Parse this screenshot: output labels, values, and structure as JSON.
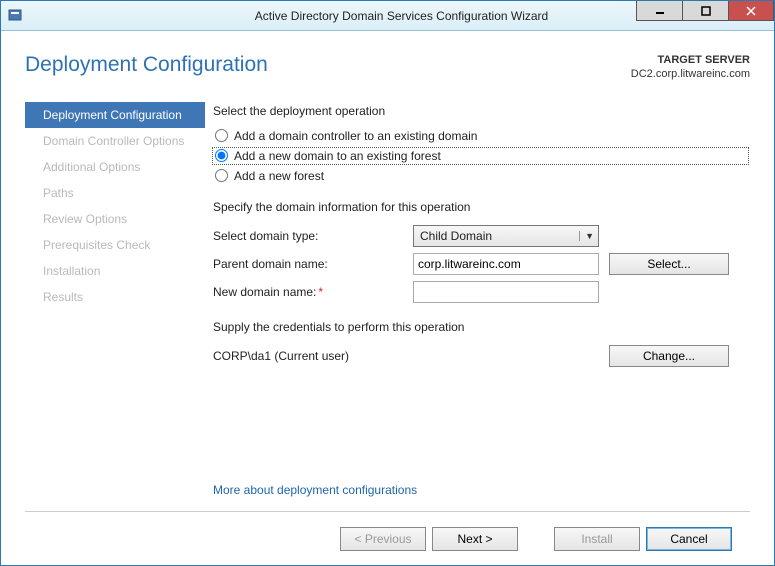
{
  "window": {
    "title": "Active Directory Domain Services Configuration Wizard"
  },
  "header": {
    "page_title": "Deployment Configuration",
    "target_label": "TARGET SERVER",
    "target_server": "DC2.corp.litwareinc.com"
  },
  "sidebar": {
    "items": [
      {
        "label": "Deployment Configuration",
        "active": true
      },
      {
        "label": "Domain Controller Options"
      },
      {
        "label": "Additional Options"
      },
      {
        "label": "Paths"
      },
      {
        "label": "Review Options"
      },
      {
        "label": "Prerequisites Check"
      },
      {
        "label": "Installation"
      },
      {
        "label": "Results"
      }
    ]
  },
  "main": {
    "select_op_label": "Select the deployment operation",
    "radios": {
      "r1": "Add a domain controller to an existing domain",
      "r2": "Add a new domain to an existing forest",
      "r3": "Add a new forest"
    },
    "specify_label": "Specify the domain information for this operation",
    "domain_type_label": "Select domain type:",
    "domain_type_value": "Child Domain",
    "parent_label": "Parent domain name:",
    "parent_value": "corp.litwareinc.com",
    "select_btn": "Select...",
    "newdomain_label": "New domain name:",
    "newdomain_value": "",
    "creds_label": "Supply the credentials to perform this operation",
    "creds_value": "CORP\\da1 (Current user)",
    "change_btn": "Change...",
    "more_link": "More about deployment configurations"
  },
  "footer": {
    "previous": "< Previous",
    "next": "Next >",
    "install": "Install",
    "cancel": "Cancel"
  }
}
